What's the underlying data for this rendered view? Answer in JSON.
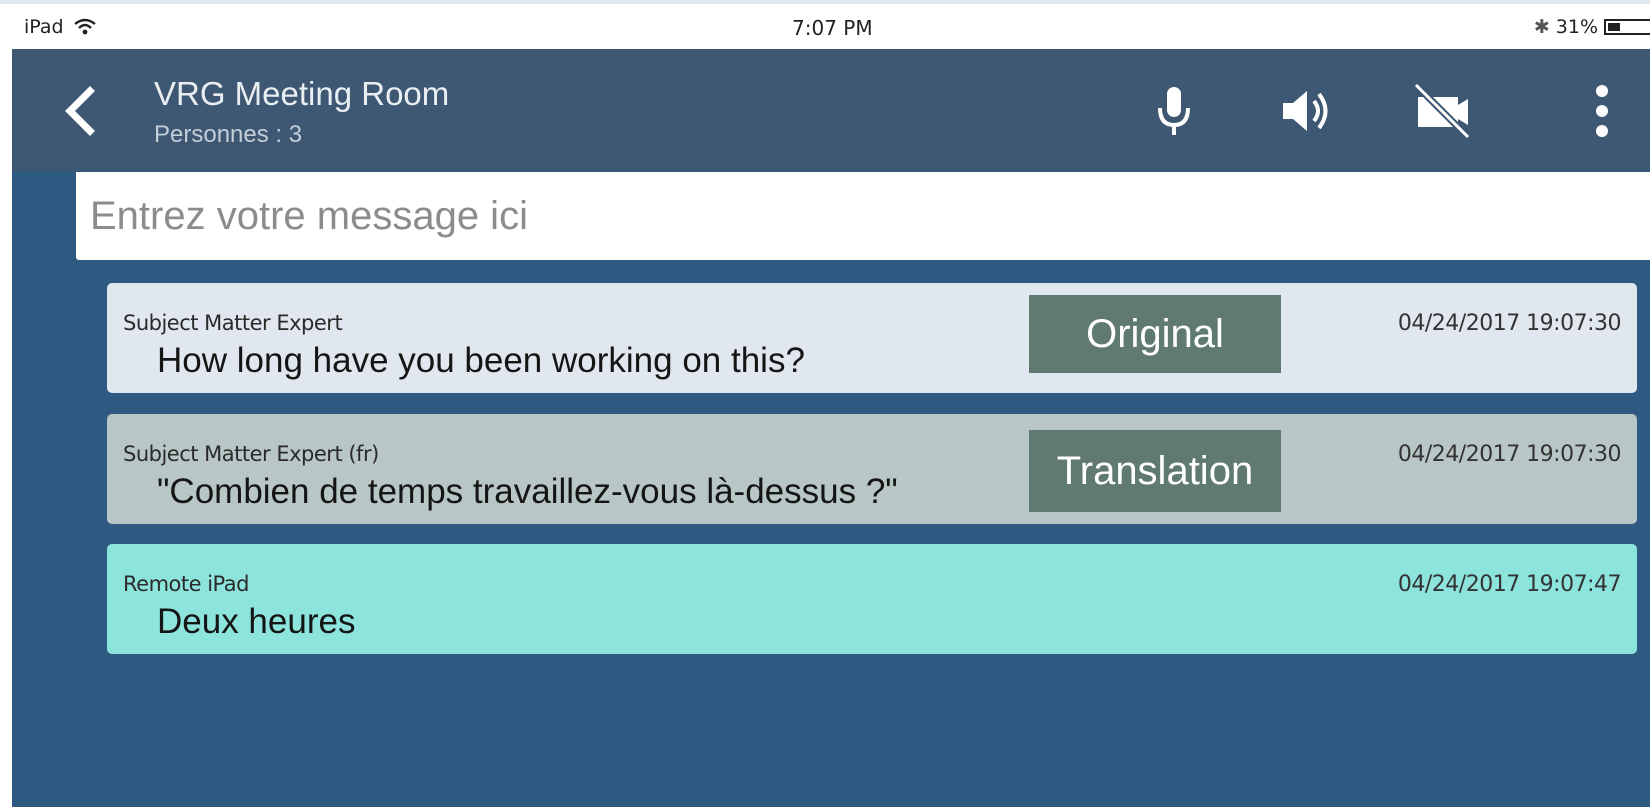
{
  "status_bar": {
    "device": "iPad",
    "time": "7:07 PM",
    "battery": "31%",
    "icons": [
      "wifi-icon",
      "bluetooth-icon",
      "battery-icon"
    ]
  },
  "header": {
    "title": "VRG Meeting Room",
    "subtitle": "Personnes : 3",
    "icons": [
      "back-icon",
      "mic-icon",
      "speaker-icon",
      "video-off-icon",
      "more-icon"
    ]
  },
  "input": {
    "placeholder": "Entrez votre message ici"
  },
  "messages": [
    {
      "sender": "Subject Matter Expert",
      "text": "How long have you been working on this?",
      "timestamp": "04/24/2017 19:07:30",
      "tag": "Original"
    },
    {
      "sender": "Subject Matter Expert (fr)",
      "text": "\"Combien de temps travaillez-vous là-dessus ?\"",
      "timestamp": "04/24/2017 19:07:30",
      "tag": "Translation"
    },
    {
      "sender": "Remote iPad",
      "text": "Deux heures",
      "timestamp": "04/24/2017 19:07:47"
    }
  ],
  "colors": {
    "header": "#3e5874",
    "app_background": "#2e5a82",
    "original_bg": "#e1e7ef",
    "translation_bg": "#b8c6c6",
    "remote_bg": "#8ce4dc",
    "tag_button": "#607a72"
  }
}
